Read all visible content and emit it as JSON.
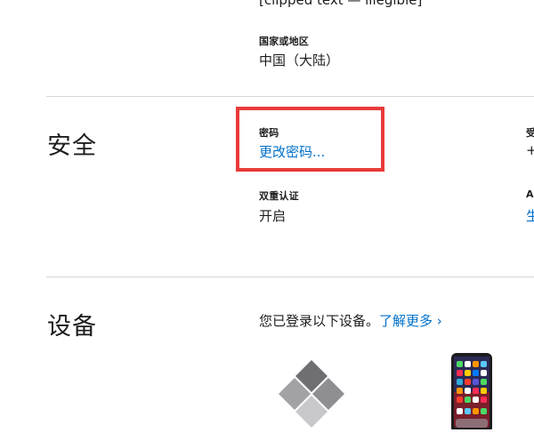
{
  "account": {
    "clipped_top_text": "[clipped text — illegible]",
    "country_label": "国家或地区",
    "country_value": "中国（大陆）"
  },
  "security": {
    "title": "安全",
    "password_label": "密码",
    "password_action": "更改密码...",
    "two_factor_label": "双重认证",
    "two_factor_value": "开启",
    "right_label_1": "受",
    "right_value_1": "+",
    "right_label_2": "A",
    "right_value_2": "生"
  },
  "devices": {
    "title": "设备",
    "description": "您已登录以下设备。",
    "learn_more": "了解更多 ›"
  },
  "colors": {
    "link": "#0070c9",
    "highlight_border": "#e83a3a",
    "divider": "#d6d6d6"
  },
  "icons": {
    "windows_device": "windows-pc-icon",
    "iphone_device": "iphone-icon"
  }
}
